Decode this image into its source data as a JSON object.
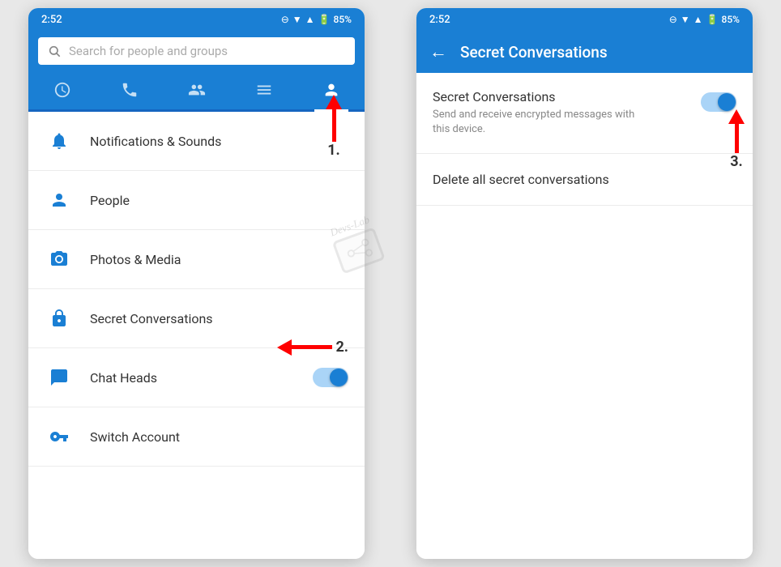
{
  "statusBar": {
    "time": "2:52",
    "battery": "85%"
  },
  "screen1": {
    "searchPlaceholder": "Search for people and groups",
    "navTabs": [
      {
        "icon": "🕐",
        "label": "recent",
        "active": false
      },
      {
        "icon": "📞",
        "label": "calls",
        "active": false
      },
      {
        "icon": "👥",
        "label": "people",
        "active": false
      },
      {
        "icon": "☰",
        "label": "menu",
        "active": false
      },
      {
        "icon": "👤",
        "label": "profile",
        "active": true
      }
    ],
    "menuItems": [
      {
        "icon": "🔔",
        "label": "Notifications & Sounds",
        "hasToggle": false,
        "toggleOn": false
      },
      {
        "icon": "👤",
        "label": "People",
        "hasToggle": false,
        "toggleOn": false
      },
      {
        "icon": "📷",
        "label": "Photos & Media",
        "hasToggle": false,
        "toggleOn": false
      },
      {
        "icon": "🔒",
        "label": "Secret Conversations",
        "hasToggle": false,
        "toggleOn": false
      },
      {
        "icon": "💬",
        "label": "Chat Heads",
        "hasToggle": true,
        "toggleOn": true
      },
      {
        "icon": "🔑",
        "label": "Switch Account",
        "hasToggle": false,
        "toggleOn": false
      }
    ],
    "annotation1": "1.",
    "annotation2": "2."
  },
  "screen2": {
    "headerTitle": "Secret Conversations",
    "backLabel": "←",
    "settingTitle": "Secret Conversations",
    "settingDesc": "Send and receive encrypted messages with this device.",
    "settingToggleOn": true,
    "deletLabel": "Delete all secret conversations",
    "annotation3": "3."
  }
}
